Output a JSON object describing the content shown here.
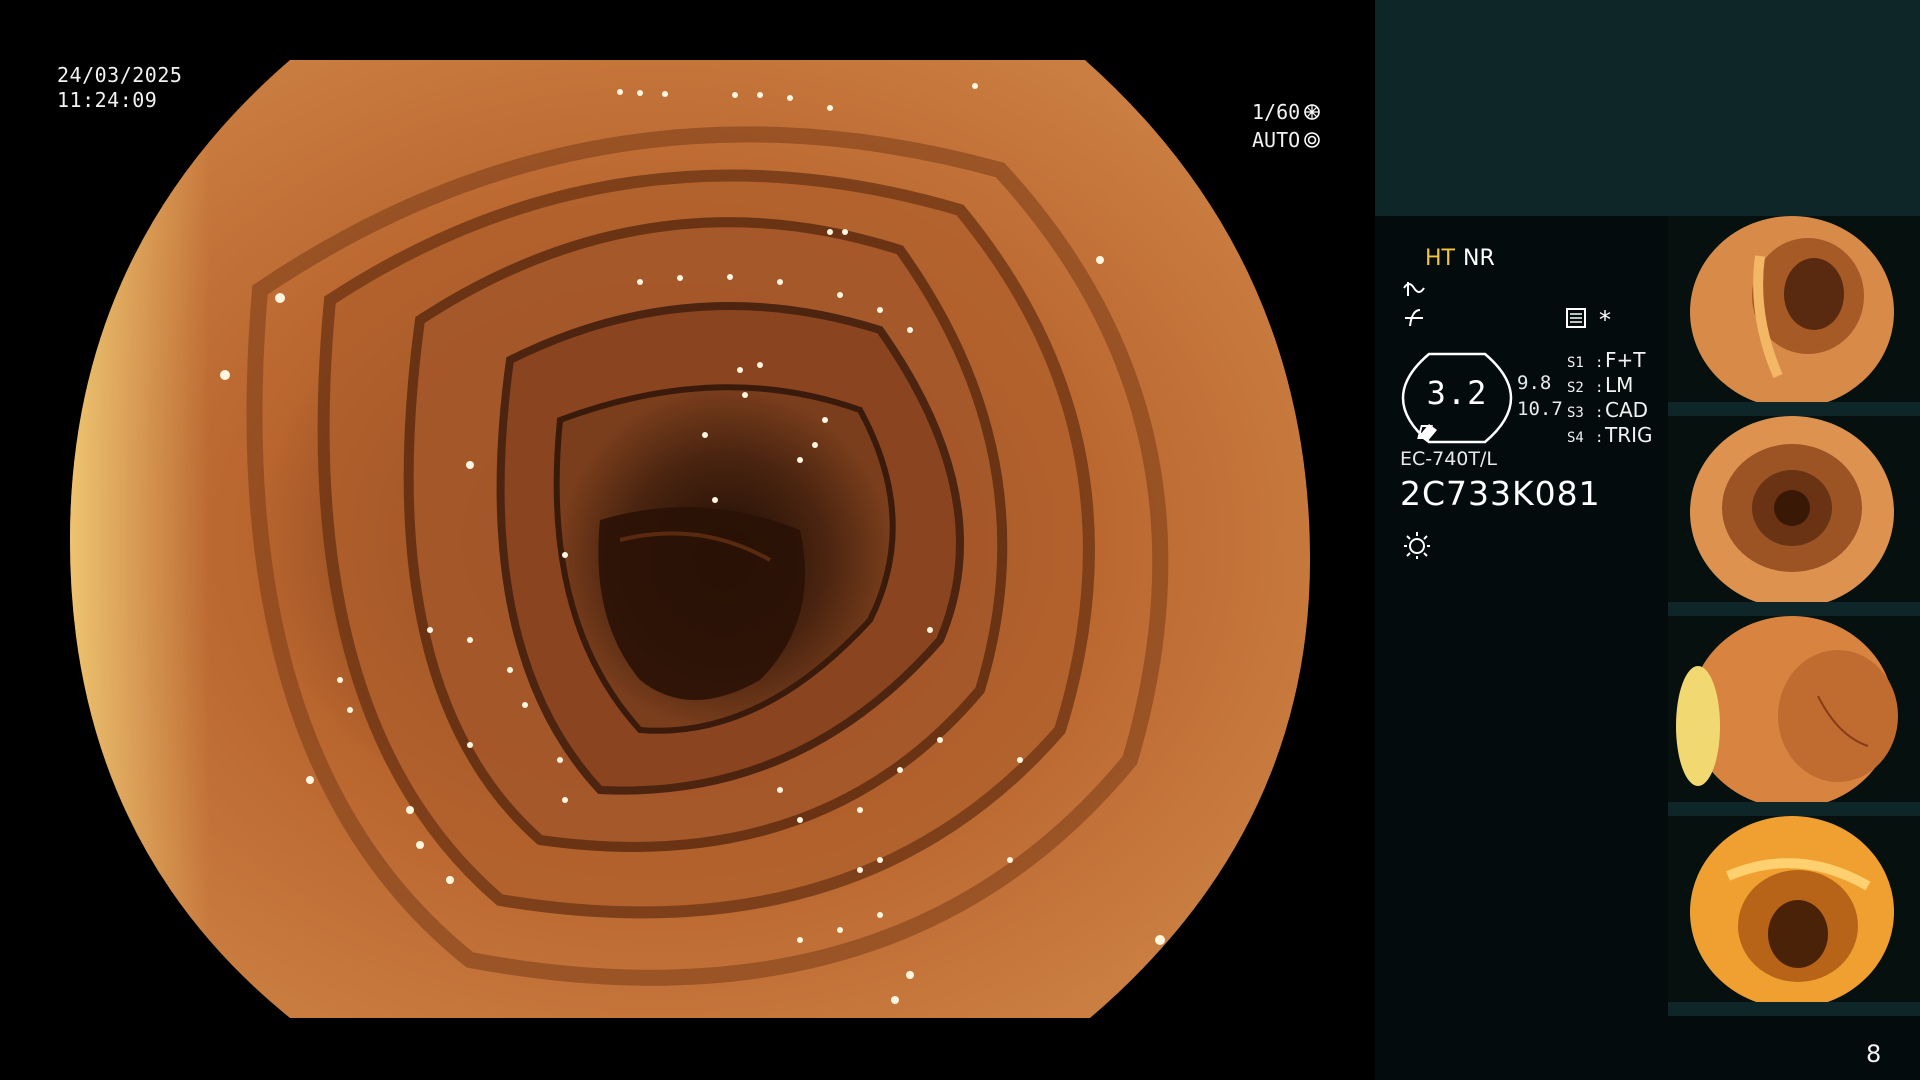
{
  "osd": {
    "date": "24/03/2025",
    "time": "11:24:09",
    "shutter": "1/60",
    "exposure_mode": "AUTO"
  },
  "panel": {
    "ht": "HT",
    "nr": "NR",
    "star": "*",
    "gauge_value": "3.2",
    "value_a": "9.8",
    "value_b": "10.7",
    "scope_settings": [
      {
        "key": "S1",
        "value": "F+T"
      },
      {
        "key": "S2",
        "value": "LM"
      },
      {
        "key": "S3",
        "value": "CAD"
      },
      {
        "key": "S4",
        "value": "TRIG"
      }
    ],
    "scope_model": "EC-740T/L",
    "serial": "2C733K081",
    "page_number": "8",
    "ht_color": "#f3c53b",
    "panel_top_color": "#0e2628"
  },
  "icons": [
    "shutter-icon",
    "auto-iris-icon",
    "structure-enhance-icon",
    "color-enhance-icon",
    "menu-icon",
    "light-icon"
  ],
  "thumbnails": [
    {
      "label": "capture-1"
    },
    {
      "label": "capture-2"
    },
    {
      "label": "capture-3"
    },
    {
      "label": "capture-4"
    }
  ]
}
